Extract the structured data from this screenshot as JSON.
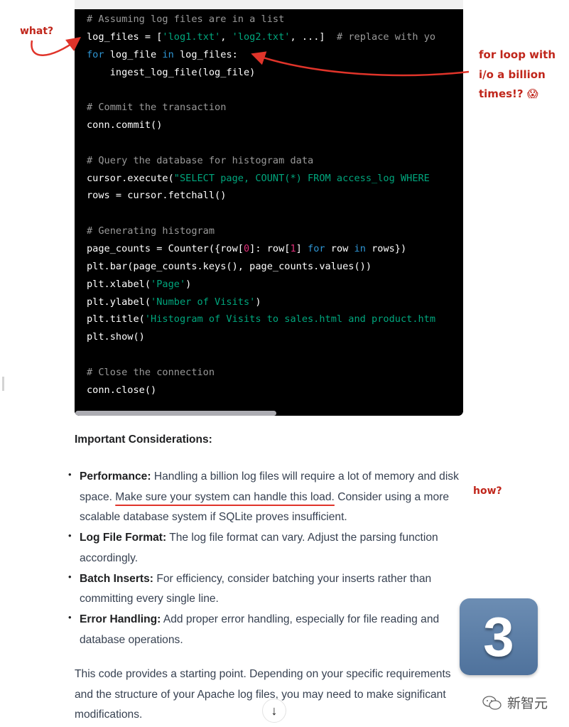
{
  "code_block": {
    "lines": [
      [
        {
          "t": "comment",
          "v": "# Assuming log files are in a list"
        }
      ],
      [
        {
          "t": "plain",
          "v": "log_files = ["
        },
        {
          "t": "str",
          "v": "'log1.txt'"
        },
        {
          "t": "plain",
          "v": ", "
        },
        {
          "t": "str",
          "v": "'log2.txt'"
        },
        {
          "t": "plain",
          "v": ", ...]  "
        },
        {
          "t": "comment",
          "v": "# replace with yo"
        }
      ],
      [
        {
          "t": "kw",
          "v": "for"
        },
        {
          "t": "plain",
          "v": " log_file "
        },
        {
          "t": "kw",
          "v": "in"
        },
        {
          "t": "plain",
          "v": " log_files:"
        }
      ],
      [
        {
          "t": "plain",
          "v": "    ingest_log_file(log_file)"
        }
      ],
      [
        {
          "t": "plain",
          "v": ""
        }
      ],
      [
        {
          "t": "comment",
          "v": "# Commit the transaction"
        }
      ],
      [
        {
          "t": "plain",
          "v": "conn.commit()"
        }
      ],
      [
        {
          "t": "plain",
          "v": ""
        }
      ],
      [
        {
          "t": "comment",
          "v": "# Query the database for histogram data"
        }
      ],
      [
        {
          "t": "plain",
          "v": "cursor.execute("
        },
        {
          "t": "str",
          "v": "\"SELECT page, COUNT(*) FROM access_log WHERE "
        }
      ],
      [
        {
          "t": "plain",
          "v": "rows = cursor.fetchall()"
        }
      ],
      [
        {
          "t": "plain",
          "v": ""
        }
      ],
      [
        {
          "t": "comment",
          "v": "# Generating histogram"
        }
      ],
      [
        {
          "t": "plain",
          "v": "page_counts = Counter({row["
        },
        {
          "t": "num",
          "v": "0"
        },
        {
          "t": "plain",
          "v": "]: row["
        },
        {
          "t": "num",
          "v": "1"
        },
        {
          "t": "plain",
          "v": "] "
        },
        {
          "t": "kw",
          "v": "for"
        },
        {
          "t": "plain",
          "v": " row "
        },
        {
          "t": "kw",
          "v": "in"
        },
        {
          "t": "plain",
          "v": " rows})"
        }
      ],
      [
        {
          "t": "plain",
          "v": "plt.bar(page_counts.keys(), page_counts.values())"
        }
      ],
      [
        {
          "t": "plain",
          "v": "plt.xlabel("
        },
        {
          "t": "str",
          "v": "'Page'"
        },
        {
          "t": "plain",
          "v": ")"
        }
      ],
      [
        {
          "t": "plain",
          "v": "plt.ylabel("
        },
        {
          "t": "str",
          "v": "'Number of Visits'"
        },
        {
          "t": "plain",
          "v": ")"
        }
      ],
      [
        {
          "t": "plain",
          "v": "plt.title("
        },
        {
          "t": "str",
          "v": "'Histogram of Visits to sales.html and product.htm"
        }
      ],
      [
        {
          "t": "plain",
          "v": "plt.show()"
        }
      ],
      [
        {
          "t": "plain",
          "v": ""
        }
      ],
      [
        {
          "t": "comment",
          "v": "# Close the connection"
        }
      ],
      [
        {
          "t": "plain",
          "v": "conn.close()"
        }
      ]
    ],
    "horizontal_scroll_fraction": 0.52
  },
  "considerations": {
    "title": "Important Considerations:",
    "items": [
      {
        "label": "Performance:",
        "text_before": " Handling a billion log files will require a lot of memory and disk space. ",
        "underlined": "Make sure your system can handle this load.",
        "text_after": " Consider using a more scalable database system if SQLite proves insufficient."
      },
      {
        "label": "Log File Format:",
        "text_before": " The log file format can vary. Adjust the parsing function accordingly.",
        "underlined": "",
        "text_after": ""
      },
      {
        "label": "Batch Inserts:",
        "text_before": " For efficiency, consider batching your inserts rather than committing every single line.",
        "underlined": "",
        "text_after": ""
      },
      {
        "label": "Error Handling:",
        "text_before": " Add proper error handling, especially for file reading and database operations.",
        "underlined": "",
        "text_after": ""
      }
    ]
  },
  "closing_paragraph": "This code provides a starting point. Depending on your specific requirements and the structure of your Apache log files, you may need to make significant modifications.",
  "annotations": {
    "what": "what?",
    "for_loop": "for loop with i/o a billion times!?",
    "for_loop_emoji": "😱",
    "how": "how?",
    "color": "#c0261b"
  },
  "badge": {
    "number": "3",
    "color": "#5a7ca6"
  },
  "scroll_down_icon": "↓",
  "watermark": {
    "icon": "wechat-icon",
    "text": "新智元"
  }
}
